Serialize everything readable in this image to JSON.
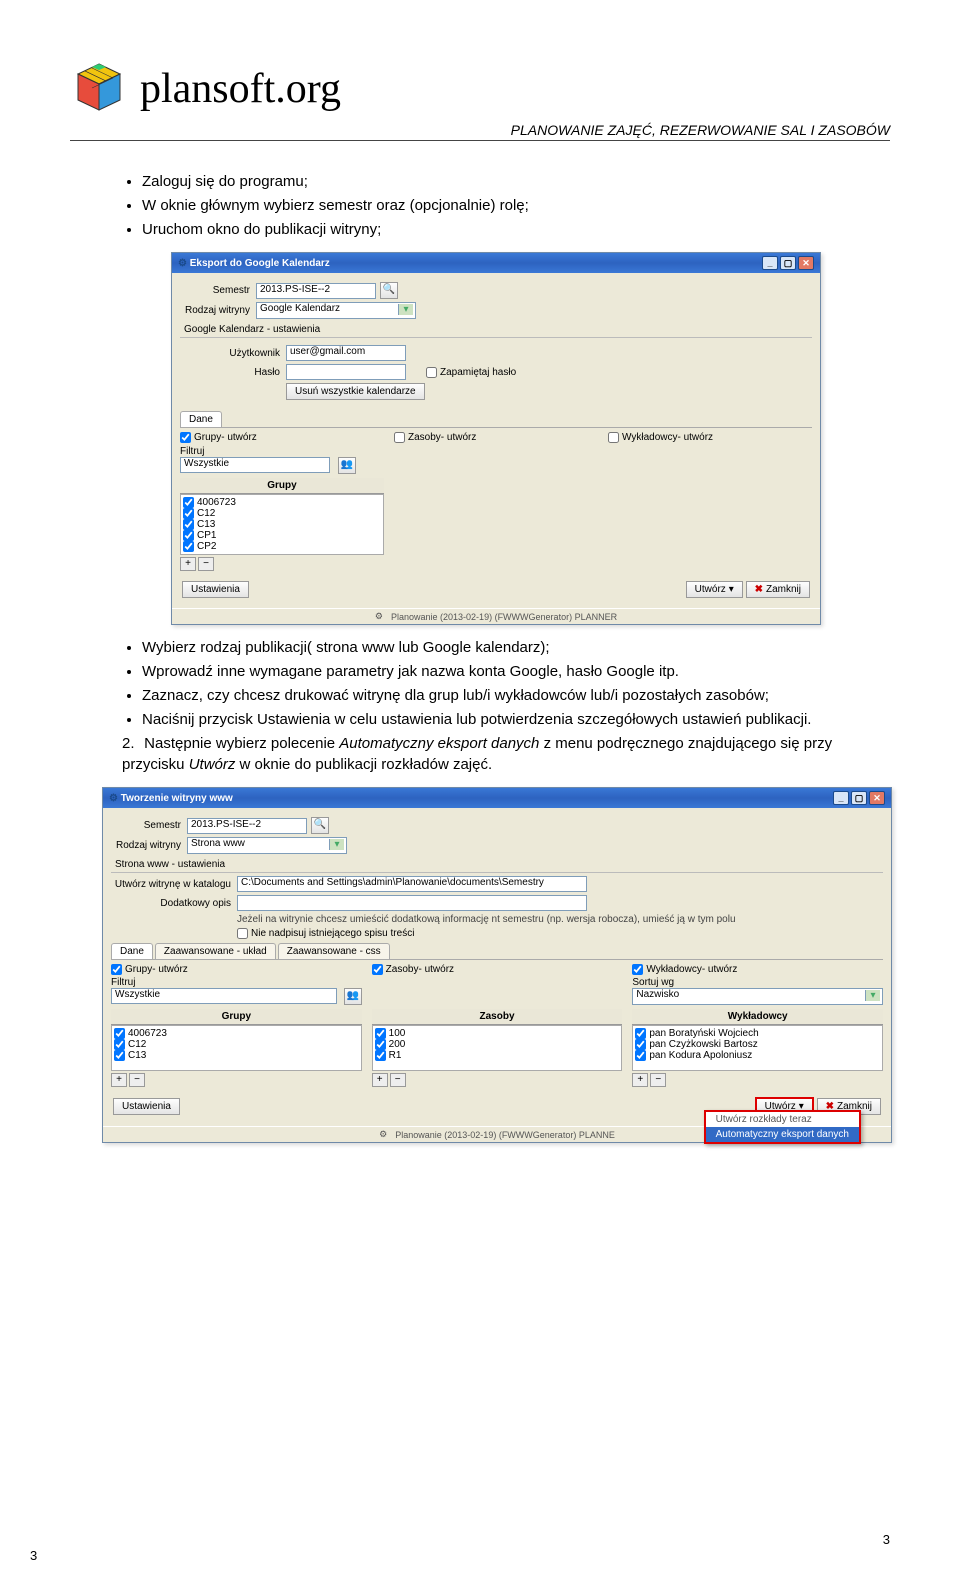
{
  "header": {
    "brand": "plansoft.org",
    "subtitle": "PLANOWANIE ZAJĘĆ, REZERWOWANIE SAL I ZASOBÓW"
  },
  "bullets_a": [
    "Zaloguj się do programu;",
    "W oknie głównym wybierz semestr oraz (opcjonalnie) rolę;",
    "Uruchom okno do publikacji witryny;"
  ],
  "bullets_b": [
    "Wybierz rodzaj publikacji( strona www lub Google kalendarz);",
    "Wprowadź inne wymagane parametry jak nazwa konta Google, hasło Google itp.",
    "Zaznacz, czy chcesz drukować witrynę dla grup lub/i wykładowców lub/i pozostałych zasobów;",
    "Naciśnij przycisk Ustawienia w celu ustawienia lub potwierdzenia szczegółowych ustawień publikacji."
  ],
  "step2": {
    "num": "2.",
    "text_a": "Następnie wybierz polecenie ",
    "italic_a": "Automatyczny eksport danych",
    "text_b": " z menu podręcznego znajdującego się przy przycisku ",
    "italic_b": "Utwórz",
    "text_c": " w oknie do publikacji rozkładów zajęć."
  },
  "win1": {
    "title": "Eksport do Google Kalendarz",
    "labels": {
      "semestr": "Semestr",
      "rodzaj": "Rodzaj witryny",
      "section_google": "Google Kalendarz - ustawienia",
      "uzytkownik": "Użytkownik",
      "haslo": "Hasło",
      "zapamietaj": "Zapamiętaj hasło",
      "usun": "Usuń wszystkie kalendarze",
      "dane": "Dane",
      "grupy_chk": "Grupy- utwórz",
      "zasoby_chk": "Zasoby- utwórz",
      "wykladowcy_chk": "Wykładowcy- utwórz",
      "filtruj": "Filtruj",
      "grupy": "Grupy"
    },
    "values": {
      "semestr": "2013.PS-ISE--2",
      "rodzaj": "Google Kalendarz",
      "uzytkownik": "user@gmail.com",
      "haslo": "",
      "filtruj": "Wszystkie"
    },
    "group_list": [
      "4006723",
      "C12",
      "C13",
      "CP1",
      "CP2"
    ],
    "buttons": {
      "ustawienia": "Ustawienia",
      "utworz": "Utwórz",
      "zamknij": "Zamknij"
    },
    "status": "Planowanie (2013-02-19) (FWWWGenerator)   PLANNER"
  },
  "win2": {
    "title": "Tworzenie witryny www",
    "labels": {
      "semestr": "Semestr",
      "rodzaj": "Rodzaj witryny",
      "section_www": "Strona www - ustawienia",
      "katalog": "Utwórz witrynę w katalogu",
      "dodatkowy": "Dodatkowy opis",
      "hint": "Jeżeli na witrynie chcesz umieścić dodatkową informację nt semestru (np. wersja robocza), umieść ją w tym polu",
      "nie_nadpisuj": "Nie nadpisuj istniejącego spisu treści",
      "dane": "Dane",
      "tab_uklad": "Zaawansowane - układ",
      "tab_css": "Zaawansowane - css",
      "grupy_chk": "Grupy- utwórz",
      "zasoby_chk": "Zasoby- utwórz",
      "wykladowcy_chk": "Wykładowcy- utwórz",
      "sortuj": "Sortuj wg",
      "filtruj": "Filtruj",
      "grupy": "Grupy",
      "zasoby": "Zasoby",
      "wykladowcy": "Wykładowcy"
    },
    "values": {
      "semestr": "2013.PS-ISE--2",
      "rodzaj": "Strona www",
      "katalog": "C:\\Documents and Settings\\admin\\Planowanie\\documents\\Semestry",
      "dodatkowy": "",
      "sortuj": "Nazwisko",
      "filtruj": "Wszystkie"
    },
    "group_list": [
      "4006723",
      "C12",
      "C13"
    ],
    "zasoby_list": [
      "100",
      "200",
      "R1"
    ],
    "wyk_list": [
      "pan Boratyński Wojciech",
      "pan Czyżkowski Bartosz",
      "pan Kodura Apoloniusz"
    ],
    "buttons": {
      "ustawienia": "Ustawienia",
      "utworz": "Utwórz",
      "zamknij": "Zamknij"
    },
    "menu": {
      "item1": "Utwórz rozkłady teraz",
      "item2": "Automatyczny eksport danych"
    },
    "status": "Planowanie (2013-02-19) (FWWWGenerator)   PLANNE"
  },
  "page_num": "3"
}
